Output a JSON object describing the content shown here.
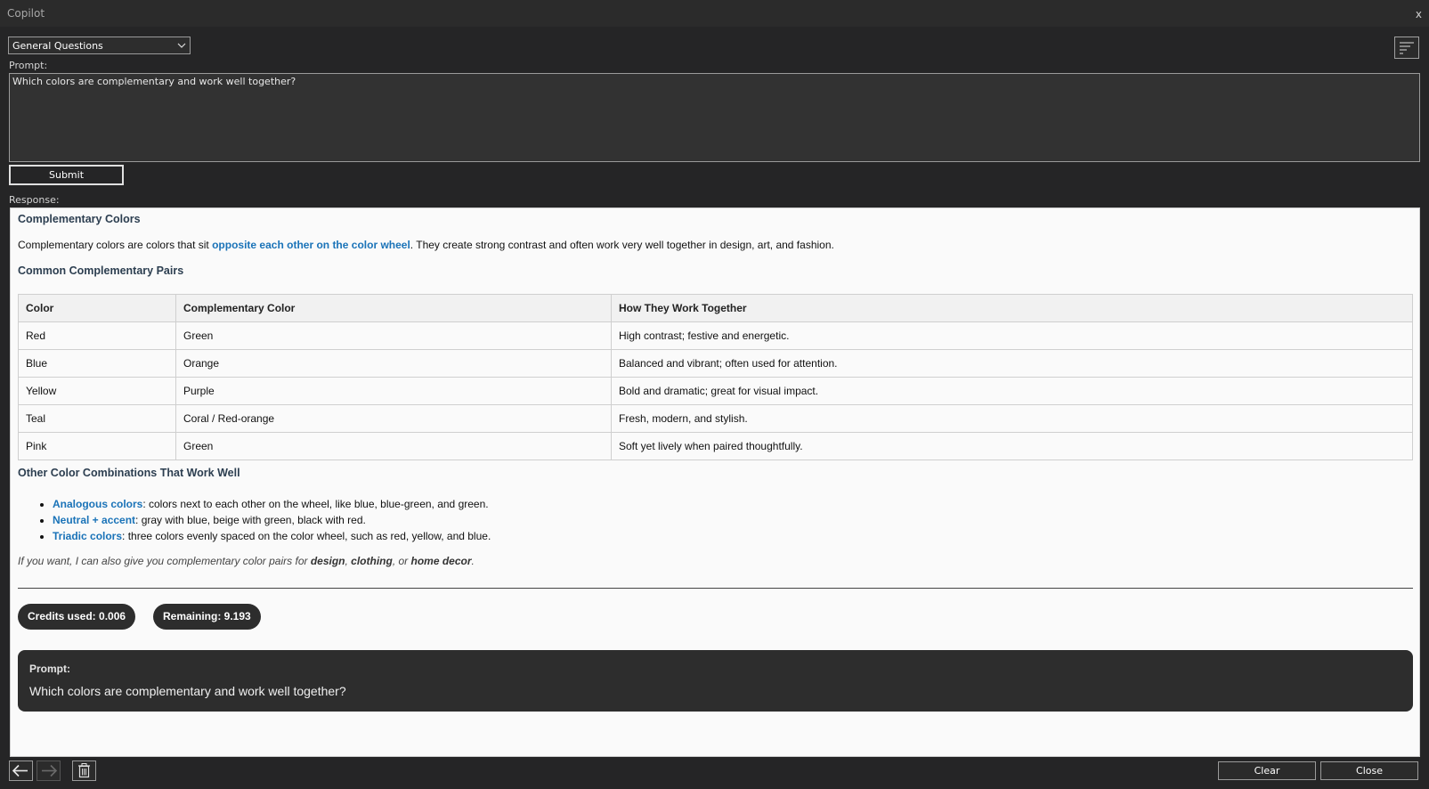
{
  "window": {
    "title": "Copilot",
    "close_glyph": "x"
  },
  "mode_select": {
    "value": "General Questions"
  },
  "prompt": {
    "label": "Prompt:",
    "value": "Which colors are complementary and work well together?",
    "submit_label": "Submit"
  },
  "response": {
    "label": "Response:",
    "heading": "Complementary Colors",
    "intro_before": "Complementary colors are colors that sit ",
    "intro_highlight": "opposite each other on the color wheel",
    "intro_after": ". They create strong contrast and often work very well together in design, art, and fashion.",
    "pairs_heading": "Common Complementary Pairs",
    "table": {
      "headers": [
        "Color",
        "Complementary Color",
        "How They Work Together"
      ],
      "rows": [
        [
          "Red",
          "Green",
          "High contrast; festive and energetic."
        ],
        [
          "Blue",
          "Orange",
          "Balanced and vibrant; often used for attention."
        ],
        [
          "Yellow",
          "Purple",
          "Bold and dramatic; great for visual impact."
        ],
        [
          "Teal",
          "Coral / Red-orange",
          "Fresh, modern, and stylish."
        ],
        [
          "Pink",
          "Green",
          "Soft yet lively when paired thoughtfully."
        ]
      ]
    },
    "other_heading": "Other Color Combinations That Work Well",
    "bullets": [
      {
        "term": "Analogous colors",
        "text": ": colors next to each other on the wheel, like blue, blue-green, and green."
      },
      {
        "term": "Neutral + accent",
        "text": ": gray with blue, beige with green, black with red."
      },
      {
        "term": "Triadic colors",
        "text": ": three colors evenly spaced on the color wheel, such as red, yellow, and blue."
      }
    ],
    "note": {
      "p1": "If you want, I can also give you complementary color pairs for ",
      "b1": "design",
      "p2": ", ",
      "b2": "clothing",
      "p3": ", or ",
      "b3": "home decor",
      "p4": "."
    },
    "credits_used": "Credits used: 0.006",
    "remaining": "Remaining: 9.193",
    "prompt_card": {
      "heading": "Prompt:",
      "text": "Which colors are complementary and work well together?"
    }
  },
  "footer": {
    "clear_label": "Clear",
    "close_label": "Close"
  },
  "icons": [
    "chevron-down-icon",
    "menu-icon",
    "arrow-left-icon",
    "arrow-right-icon",
    "trash-icon"
  ],
  "colors": {
    "accent_link": "#1a73b8",
    "background": "#252526",
    "response_bg": "#fafafa",
    "pill_bg": "#2d2d2d"
  }
}
